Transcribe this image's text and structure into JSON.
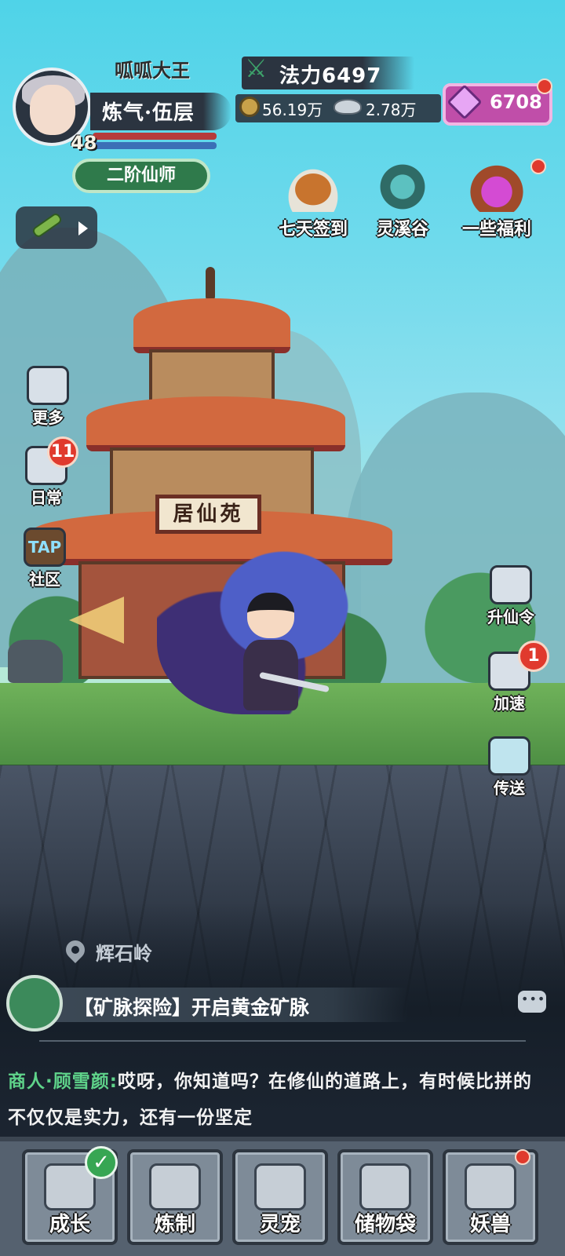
{
  "player": {
    "name": "呱呱大王",
    "realm": "炼气·伍层",
    "level": "48",
    "title": "二阶仙师",
    "power_label": "法力6497"
  },
  "currency": {
    "copper": "56.19万",
    "silver": "2.78万",
    "gems": "6708"
  },
  "events": [
    {
      "label": "七天签到",
      "icon": "roast-chicken-icon"
    },
    {
      "label": "灵溪谷",
      "icon": "spirit-valley-icon"
    },
    {
      "label": "一些福利",
      "icon": "gem-bag-icon",
      "has_dot": true
    }
  ],
  "left_menu": [
    {
      "label": "更多",
      "icon": "scrolls-icon"
    },
    {
      "label": "日常",
      "icon": "scroll-icon",
      "badge": "11"
    },
    {
      "label": "社区",
      "icon": "tap-icon",
      "icon_text": "TAP"
    }
  ],
  "right_menu": [
    {
      "label": "升仙令",
      "icon": "token-icon"
    },
    {
      "label": "加速",
      "icon": "speed-icon",
      "badge": "1"
    },
    {
      "label": "传送",
      "icon": "teleport-icon"
    }
  ],
  "building_sign": "居仙苑",
  "location": "辉石岭",
  "quest": "【矿脉探险】开启黄金矿脉",
  "dialog": {
    "speaker": "商人·顾雪颜:",
    "text": "哎呀，你知道吗？在修仙的道路上，有时候比拼的不仅仅是实力，还有一份坚定"
  },
  "bottom_nav": [
    {
      "label": "成长",
      "icon": "growth-icon",
      "checked": true
    },
    {
      "label": "炼制",
      "icon": "anvil-icon"
    },
    {
      "label": "灵宠",
      "icon": "spirit-pet-icon"
    },
    {
      "label": "储物袋",
      "icon": "storage-bag-icon"
    },
    {
      "label": "妖兽",
      "icon": "demon-beast-icon",
      "has_dot": true
    }
  ],
  "colors": {
    "sky": "#4fd3e8",
    "gem_box": "#c04ea9",
    "badge_red": "#e03a2d",
    "speaker_green": "#5fd38a"
  }
}
